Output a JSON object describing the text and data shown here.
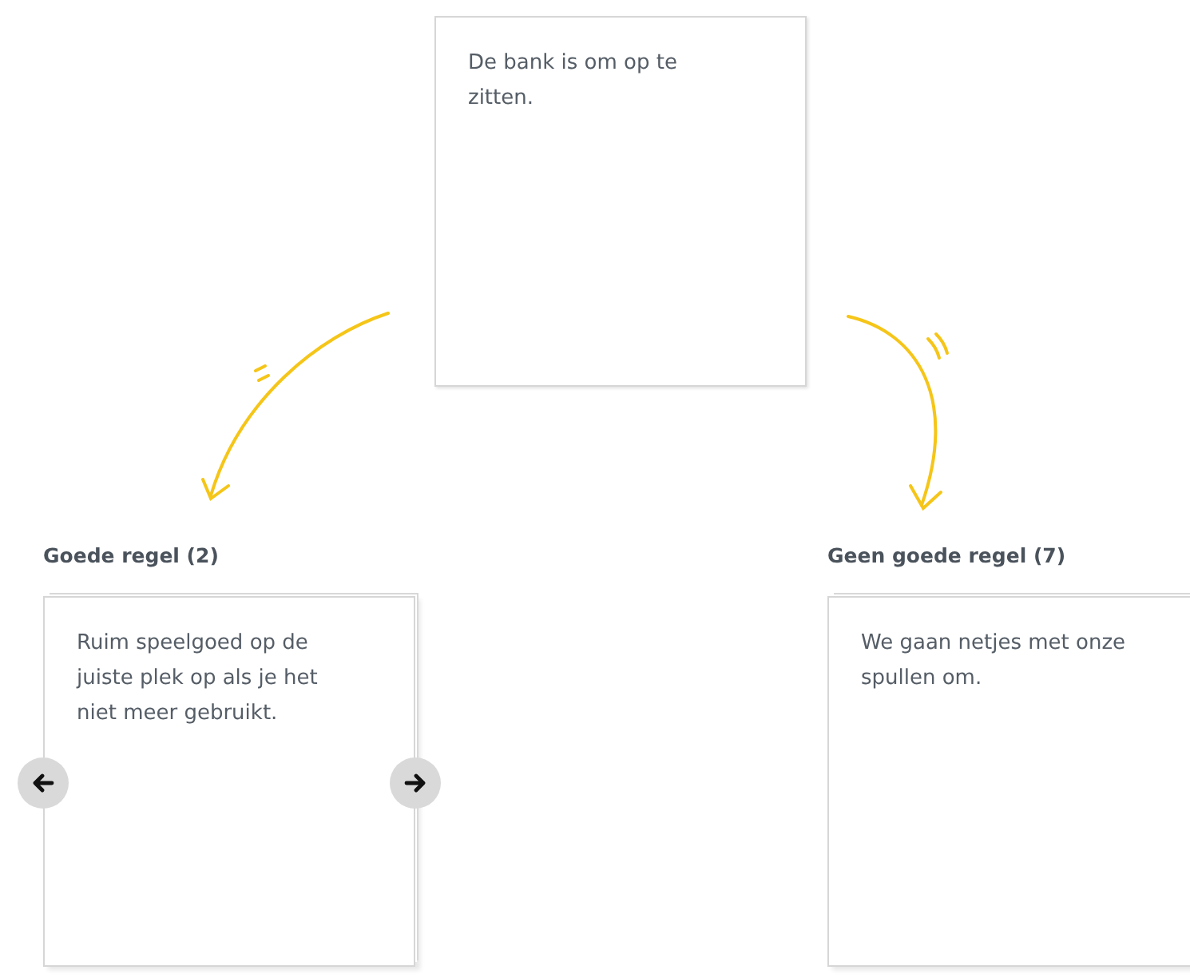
{
  "prompt_card": {
    "text": "De bank is om op te zitten."
  },
  "columns": [
    {
      "label": "Goede regel (2)",
      "card_text": "Ruim speelgoed op de juiste plek op als je het niet meer gebruikt.",
      "navigation": true
    },
    {
      "label": "Geen goede regel (7)",
      "card_text": "We gaan netjes met onze spullen om.",
      "navigation": false
    }
  ]
}
